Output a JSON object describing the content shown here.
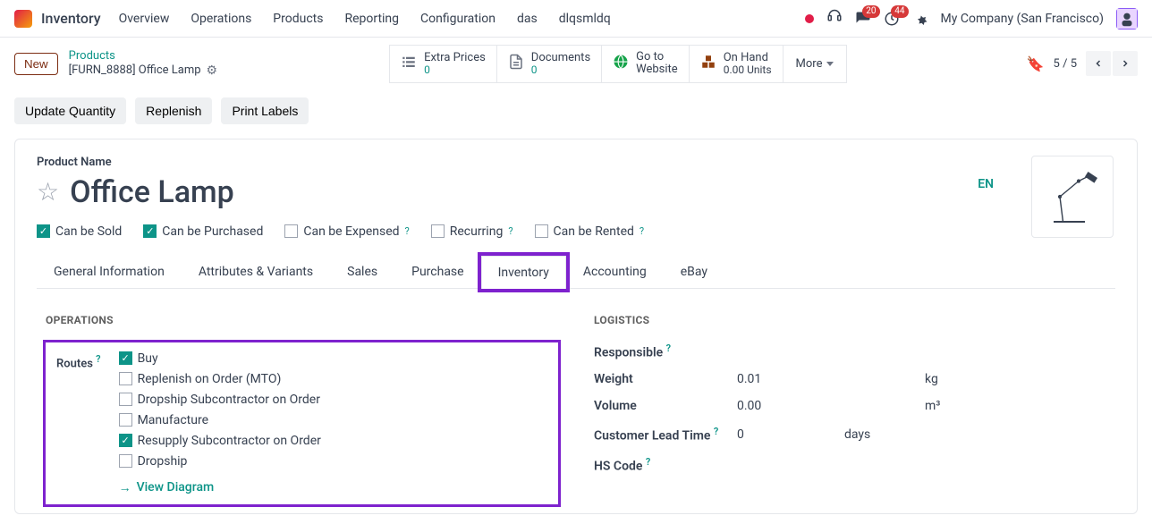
{
  "app": {
    "title": "Inventory"
  },
  "topnav": [
    "Overview",
    "Operations",
    "Products",
    "Reporting",
    "Configuration",
    "das",
    "dlqsmldq"
  ],
  "badges": {
    "chat": "20",
    "activity": "44"
  },
  "company": "My Company (San Francisco)",
  "new_btn": "New",
  "breadcrumb": {
    "parent": "Products",
    "current": "[FURN_8888] Office Lamp"
  },
  "stats": {
    "extra_prices": {
      "label": "Extra Prices",
      "value": "0"
    },
    "documents": {
      "label": "Documents",
      "value": "0"
    },
    "go_to_website": {
      "label1": "Go to",
      "label2": "Website"
    },
    "on_hand": {
      "label": "On Hand",
      "value": "0.00 Units"
    }
  },
  "more": "More",
  "pager": {
    "current": "5",
    "total": "5"
  },
  "actions": {
    "update_quantity": "Update Quantity",
    "replenish": "Replenish",
    "print_labels": "Print Labels"
  },
  "product": {
    "name_label": "Product Name",
    "name": "Office Lamp",
    "lang": "EN",
    "flags": {
      "can_be_sold": "Can be Sold",
      "can_be_purchased": "Can be Purchased",
      "can_be_expensed": "Can be Expensed",
      "recurring": "Recurring",
      "can_be_rented": "Can be Rented"
    }
  },
  "tabs": [
    "General Information",
    "Attributes & Variants",
    "Sales",
    "Purchase",
    "Inventory",
    "Accounting",
    "eBay"
  ],
  "sections": {
    "operations": "OPERATIONS",
    "logistics": "LOGISTICS"
  },
  "routes": {
    "label": "Routes",
    "items": {
      "buy": "Buy",
      "mto": "Replenish on Order (MTO)",
      "dropship_sub": "Dropship Subcontractor on Order",
      "manufacture": "Manufacture",
      "resupply_sub": "Resupply Subcontractor on Order",
      "dropship": "Dropship"
    },
    "view_diagram": "View Diagram"
  },
  "logistics": {
    "responsible": {
      "label": "Responsible"
    },
    "weight": {
      "label": "Weight",
      "value": "0.01",
      "unit": "kg"
    },
    "volume": {
      "label": "Volume",
      "value": "0.00",
      "unit": "m³"
    },
    "lead_time": {
      "label": "Customer Lead Time",
      "value": "0",
      "unit": "days"
    },
    "hs_code": {
      "label": "HS Code"
    }
  }
}
